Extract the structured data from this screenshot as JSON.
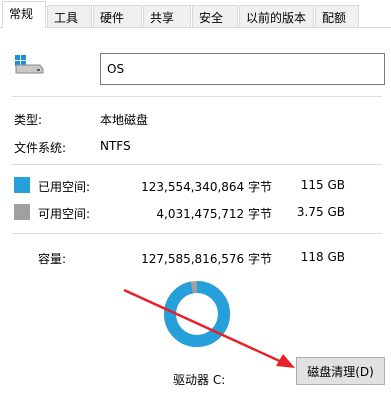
{
  "tabs": [
    {
      "label": "常规",
      "active": true
    },
    {
      "label": "工具"
    },
    {
      "label": "硬件"
    },
    {
      "label": "共享"
    },
    {
      "label": "安全"
    },
    {
      "label": "以前的版本"
    },
    {
      "label": "配额"
    }
  ],
  "drive": {
    "name_value": "OS",
    "type_label": "类型:",
    "type_value": "本地磁盘",
    "fs_label": "文件系统:",
    "fs_value": "NTFS"
  },
  "usage": {
    "used": {
      "label": "已用空间:",
      "bytes": "123,554,340,864 字节",
      "size": "115 GB",
      "color": "#26a0da"
    },
    "free": {
      "label": "可用空间:",
      "bytes": "4,031,475,712 字节",
      "size": "3.75 GB",
      "color": "#a0a0a0"
    },
    "capacity": {
      "label": "容量:",
      "bytes": "127,585,816,576 字节",
      "size": "118 GB"
    },
    "used_fraction": 0.968
  },
  "drive_label": "驱动器 C:",
  "cleanup_button": "磁盘清理(D)",
  "colors": {
    "annotation_arrow": "#e8202a"
  }
}
